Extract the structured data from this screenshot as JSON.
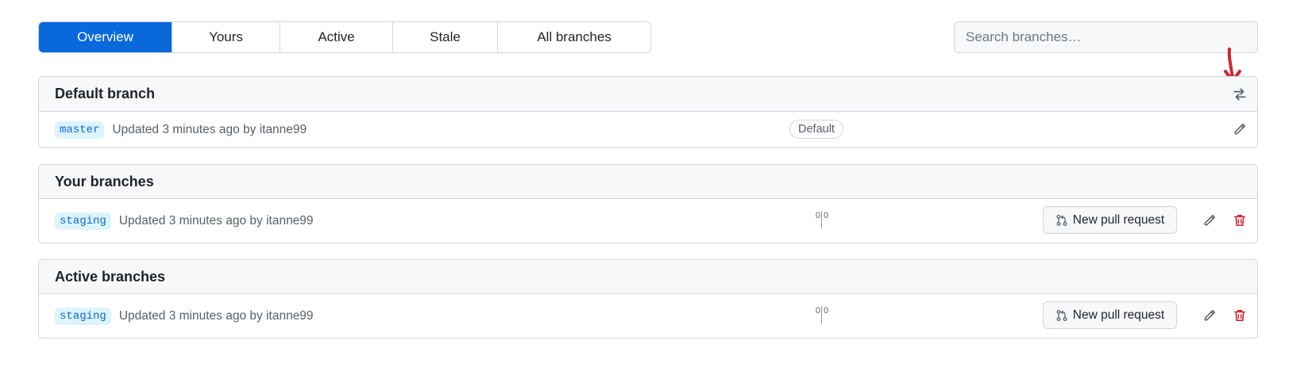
{
  "tabs": [
    {
      "label": "Overview",
      "selected": true
    },
    {
      "label": "Yours",
      "selected": false
    },
    {
      "label": "Active",
      "selected": false
    },
    {
      "label": "Stale",
      "selected": false
    },
    {
      "label": "All branches",
      "selected": false
    }
  ],
  "search": {
    "placeholder": "Search branches…",
    "value": ""
  },
  "sections": {
    "default_branch": {
      "title": "Default branch",
      "switch_icon": "arrows-switch-icon",
      "rows": [
        {
          "branch": "master",
          "updated_prefix": "Updated 3 minutes ago by",
          "author": "itanne99",
          "badge": "Default",
          "actions": [
            "pencil-icon"
          ]
        }
      ]
    },
    "your_branches": {
      "title": "Your branches",
      "rows": [
        {
          "branch": "staging",
          "updated_prefix": "Updated 3 minutes ago by",
          "author": "itanne99",
          "behind": "0",
          "ahead": "0",
          "pull_request_label": "New pull request",
          "actions": [
            "pencil-icon",
            "trash-icon"
          ]
        }
      ]
    },
    "active_branches": {
      "title": "Active branches",
      "rows": [
        {
          "branch": "staging",
          "updated_prefix": "Updated 3 minutes ago by",
          "author": "itanne99",
          "behind": "0",
          "ahead": "0",
          "pull_request_label": "New pull request",
          "actions": [
            "pencil-icon",
            "trash-icon"
          ]
        }
      ]
    }
  },
  "colors": {
    "accent": "#0969da",
    "danger": "#cf222e",
    "annotation": "#d1242f"
  }
}
